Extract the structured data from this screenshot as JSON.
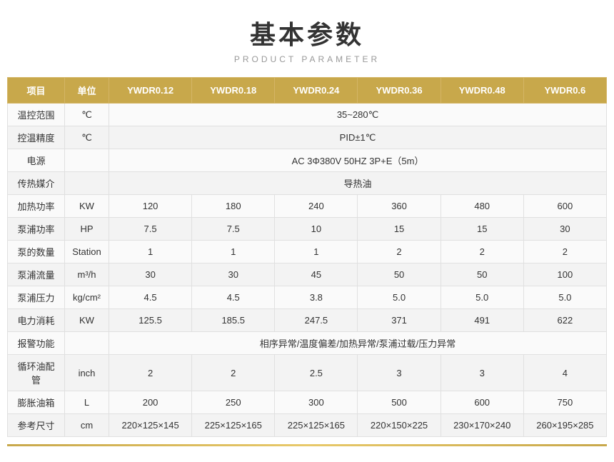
{
  "header": {
    "main_title": "基本参数",
    "sub_title": "PRODUCT PARAMETER"
  },
  "table": {
    "columns": [
      "项目",
      "单位",
      "YWDR0.12",
      "YWDR0.18",
      "YWDR0.24",
      "YWDR0.36",
      "YWDR0.48",
      "YWDR0.6"
    ],
    "rows": [
      {
        "label": "温控范围",
        "unit": "℃",
        "span": true,
        "span_value": "35~280℃"
      },
      {
        "label": "控温精度",
        "unit": "℃",
        "span": true,
        "span_value": "PID±1℃"
      },
      {
        "label": "电源",
        "unit": "",
        "span": true,
        "span_value": "AC 3Φ380V 50HZ 3P+E（5m）"
      },
      {
        "label": "传热媒介",
        "unit": "",
        "span": true,
        "span_value": "导热油"
      },
      {
        "label": "加热功率",
        "unit": "KW",
        "span": false,
        "values": [
          "120",
          "180",
          "240",
          "360",
          "480",
          "600"
        ]
      },
      {
        "label": "泵浦功率",
        "unit": "HP",
        "span": false,
        "values": [
          "7.5",
          "7.5",
          "10",
          "15",
          "15",
          "30"
        ]
      },
      {
        "label": "泵的数量",
        "unit": "Station",
        "span": false,
        "values": [
          "1",
          "1",
          "1",
          "2",
          "2",
          "2"
        ]
      },
      {
        "label": "泵浦流量",
        "unit": "m³/h",
        "span": false,
        "values": [
          "30",
          "30",
          "45",
          "50",
          "50",
          "100"
        ]
      },
      {
        "label": "泵浦压力",
        "unit": "kg/cm²",
        "span": false,
        "values": [
          "4.5",
          "4.5",
          "3.8",
          "5.0",
          "5.0",
          "5.0"
        ]
      },
      {
        "label": "电力消耗",
        "unit": "KW",
        "span": false,
        "values": [
          "125.5",
          "185.5",
          "247.5",
          "371",
          "491",
          "622"
        ]
      },
      {
        "label": "报警功能",
        "unit": "",
        "span": true,
        "span_value": "相序异常/温度偏差/加热异常/泵浦过载/压力异常"
      },
      {
        "label": "循环油配管",
        "unit": "inch",
        "span": false,
        "values": [
          "2",
          "2",
          "2.5",
          "3",
          "3",
          "4"
        ]
      },
      {
        "label": "膨胀油箱",
        "unit": "L",
        "span": false,
        "values": [
          "200",
          "250",
          "300",
          "500",
          "600",
          "750"
        ]
      },
      {
        "label": "参考尺寸",
        "unit": "cm",
        "span": false,
        "values": [
          "220×125×145",
          "225×125×165",
          "225×125×165",
          "220×150×225",
          "230×170×240",
          "260×195×285"
        ]
      }
    ]
  }
}
